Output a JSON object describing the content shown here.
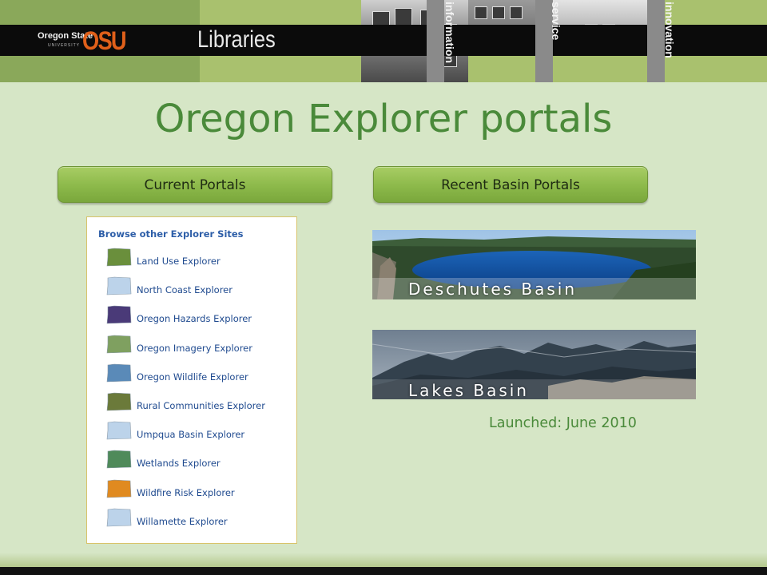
{
  "header": {
    "institution": "Oregon State",
    "institution_sub": "UNIVERSITY",
    "logo_mark": "OSU",
    "unit": "Libraries",
    "values": [
      "information",
      "service",
      "innovation"
    ]
  },
  "page_title": "Oregon Explorer portals",
  "buttons": {
    "current_portals": "Current Portals",
    "recent_basin_portals": "Recent  Basin Portals"
  },
  "explorer_sites": {
    "heading": "Browse other Explorer Sites",
    "items": [
      {
        "label": "Land Use Explorer",
        "icon": "land-use-icon",
        "color": "#6a8f3c"
      },
      {
        "label": "North Coast Explorer",
        "icon": "north-coast-icon",
        "color": "#bcd3ea"
      },
      {
        "label": "Oregon Hazards Explorer",
        "icon": "hazards-icon",
        "color": "#4a3a78"
      },
      {
        "label": "Oregon Imagery Explorer",
        "icon": "imagery-icon",
        "color": "#7fa060"
      },
      {
        "label": "Oregon Wildlife Explorer",
        "icon": "wildlife-icon",
        "color": "#5a8ab8"
      },
      {
        "label": "Rural Communities Explorer",
        "icon": "rural-communities-icon",
        "color": "#6b7a3a"
      },
      {
        "label": "Umpqua Basin Explorer",
        "icon": "umpqua-basin-icon",
        "color": "#bcd3ea"
      },
      {
        "label": "Wetlands Explorer",
        "icon": "wetlands-icon",
        "color": "#4f8a5a"
      },
      {
        "label": "Wildfire Risk Explorer",
        "icon": "wildfire-icon",
        "color": "#e08a20"
      },
      {
        "label": "Willamette Explorer",
        "icon": "willamette-icon",
        "color": "#bcd3ea"
      }
    ]
  },
  "basins": [
    {
      "label": "Deschutes Basin"
    },
    {
      "label": "Lakes Basin"
    }
  ],
  "launched": "Launched: June 2010"
}
